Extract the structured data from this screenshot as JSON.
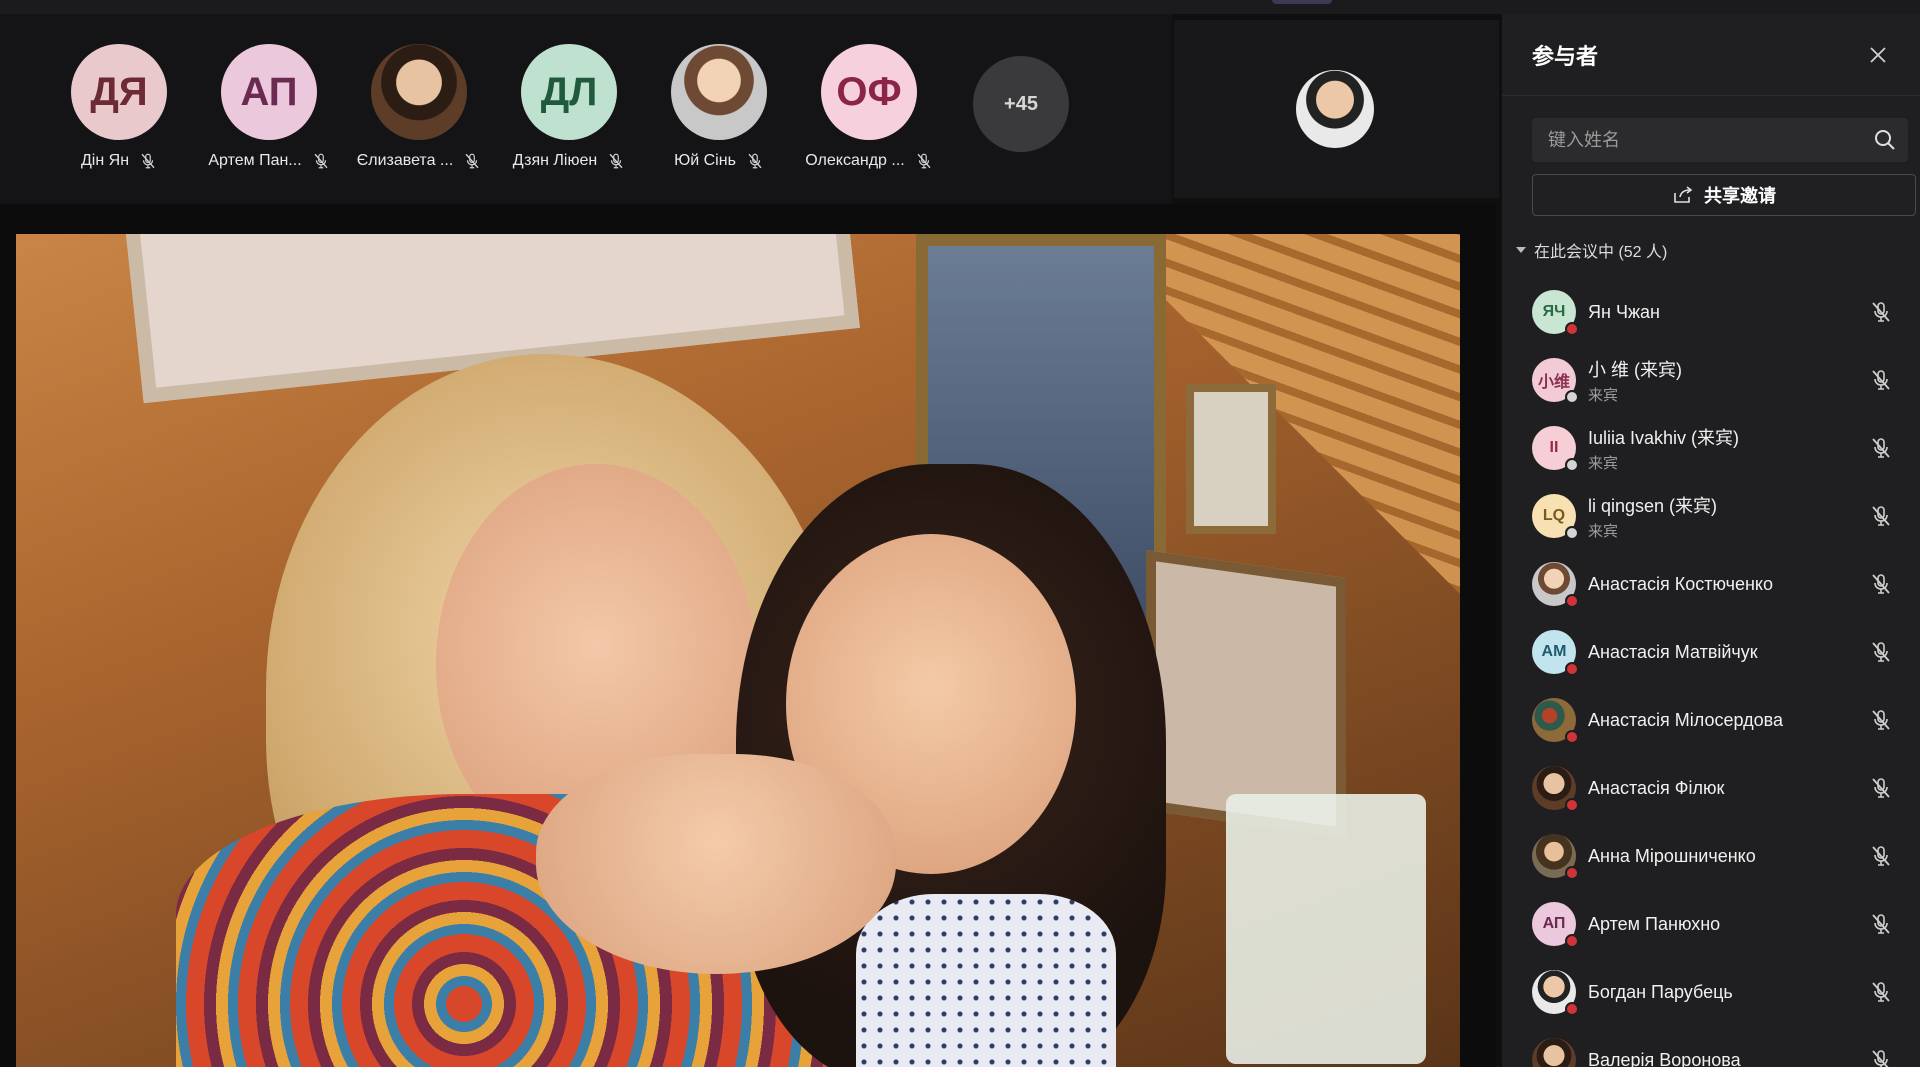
{
  "stage_strip": {
    "tiles": [
      {
        "initials": "ДЯ",
        "name": "Дін Ян",
        "bg": "#e9c9cc",
        "fg": "#6b2a36"
      },
      {
        "initials": "АП",
        "name": "Артем Пан...",
        "bg": "#ecc8dc",
        "fg": "#6b2a52"
      },
      {
        "initials": "",
        "name": "Єлизавета ...",
        "bg": "#caa07e",
        "fg": "#000000",
        "photo": true
      },
      {
        "initials": "ДЛ",
        "name": "Дзян Ліюен",
        "bg": "#bfe1cf",
        "fg": "#205a3e"
      },
      {
        "initials": "",
        "name": "Юй Сінь",
        "bg": "#e8e8e8",
        "fg": "#000000",
        "photo": true
      },
      {
        "initials": "ОФ",
        "name": "Олександр ...",
        "bg": "#f6d0dd",
        "fg": "#8a2448"
      }
    ],
    "overflow_label": "+45"
  },
  "panel": {
    "title": "参与者",
    "search_placeholder": "键入姓名",
    "share_label": "共享邀请",
    "section_label": "在此会议中 (52 人)",
    "participants": [
      {
        "initials": "ЯЧ",
        "name": "Ян Чжан",
        "sub": "",
        "bg": "#c8e6d2",
        "fg": "#2a6a45",
        "status": "#d13438"
      },
      {
        "initials": "小维",
        "name": "小 维 (来宾)",
        "sub": "来宾",
        "bg": "#f3cbd6",
        "fg": "#8a3150",
        "status": "#d4d4d4"
      },
      {
        "initials": "II",
        "name": "Iuliia Ivakhiv (来宾)",
        "sub": "来宾",
        "bg": "#f6cfd6",
        "fg": "#9a2b44",
        "status": "#d4d4d4"
      },
      {
        "initials": "LQ",
        "name": "li qingsen (来宾)",
        "sub": "来宾",
        "bg": "#f7e1b2",
        "fg": "#7a5a1a",
        "status": "#d4d4d4"
      },
      {
        "initials": "",
        "name": "Анастасія Костюченко",
        "sub": "",
        "bg": "#cccccc",
        "fg": "#000000",
        "status": "#d13438",
        "photo": "photo"
      },
      {
        "initials": "АМ",
        "name": "Анастасія Матвійчук",
        "sub": "",
        "bg": "#c2e4ef",
        "fg": "#1f5a6e",
        "status": "#d13438"
      },
      {
        "initials": "",
        "name": "Анастасія Мілосердова",
        "sub": "",
        "bg": "#555555",
        "fg": "#000000",
        "status": "#d13438",
        "photo": "photo5"
      },
      {
        "initials": "",
        "name": "Анастасія Філюк",
        "sub": "",
        "bg": "#555555",
        "fg": "#000000",
        "status": "#d13438",
        "photo": "photo2"
      },
      {
        "initials": "",
        "name": "Анна Мірошниченко",
        "sub": "",
        "bg": "#555555",
        "fg": "#000000",
        "status": "#d13438",
        "photo": "photo3"
      },
      {
        "initials": "АП",
        "name": "Артем Панюхно",
        "sub": "",
        "bg": "#ecc8dc",
        "fg": "#6b2a52",
        "status": "#d13438"
      },
      {
        "initials": "",
        "name": "Богдан Парубець",
        "sub": "",
        "bg": "#555555",
        "fg": "#000000",
        "status": "#d13438",
        "photo": "photo4"
      },
      {
        "initials": "",
        "name": "Валерія Воронова",
        "sub": "",
        "bg": "#555555",
        "fg": "#000000",
        "status": "#d13438",
        "photo": "photo2"
      }
    ]
  }
}
